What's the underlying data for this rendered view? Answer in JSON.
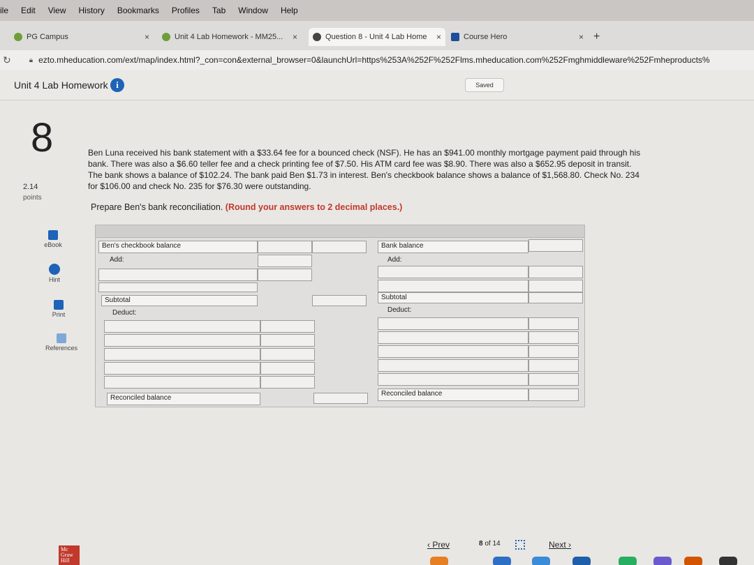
{
  "menubar": {
    "items": [
      "ile",
      "Edit",
      "View",
      "History",
      "Bookmarks",
      "Profiles",
      "Tab",
      "Window",
      "Help"
    ]
  },
  "tabs": [
    {
      "label": "PG Campus",
      "close": "×"
    },
    {
      "label": "Unit 4 Lab Homework - MM25...",
      "close": "×"
    },
    {
      "label": "Question 8 - Unit 4 Lab Home",
      "close": "×"
    },
    {
      "label": "Course Hero",
      "close": "×"
    }
  ],
  "new_tab": "+",
  "address": {
    "url": "ezto.mheducation.com/ext/map/index.html?_con=con&external_browser=0&launchUrl=https%253A%252F%252Flms.mheducation.com%252Fmghmiddleware%252Fmheproducts%"
  },
  "assignment": {
    "title": "Unit 4 Lab Homework",
    "saved": "Saved"
  },
  "question": {
    "number": "8",
    "points_value": "2.14",
    "points_label": "points",
    "text": "Ben Luna received his bank statement with a $33.64 fee for a bounced check (NSF). He has an $941.00 monthly mortgage payment paid through his bank. There was also a $6.60 teller fee and a check printing fee of $7.50. His ATM card fee was $8.90. There was also a $652.95 deposit in transit. The bank shows a balance of $102.24. The bank paid Ben $1.73 in interest. Ben's checkbook balance shows a balance of $1,568.80. Check No. 234 for $106.00 and check No. 235 for $76.30 were outstanding.",
    "prepare": "Prepare Ben's bank reconciliation.",
    "instruction": "(Round your answers to 2 decimal places.)"
  },
  "tools": [
    {
      "label": "eBook",
      "icon": "ebook-icon"
    },
    {
      "label": "Hint",
      "icon": "hint-icon"
    },
    {
      "label": "Print",
      "icon": "print-icon"
    },
    {
      "label": "References",
      "icon": "references-icon"
    }
  ],
  "recon": {
    "left": {
      "balance_label": "Ben's checkbook balance",
      "add_label": "Add:",
      "subtotal_label": "Subtotal",
      "deduct_label": "Deduct:",
      "reconciled_label": "Reconciled balance"
    },
    "right": {
      "balance_label": "Bank balance",
      "add_label": "Add:",
      "subtotal_label": "Subtotal",
      "deduct_label": "Deduct:",
      "reconciled_label": "Reconciled balance"
    }
  },
  "nav": {
    "prev": "Prev",
    "page_current": "8",
    "page_of": "of",
    "page_total": "14",
    "next": "Next"
  },
  "logo": {
    "text": "Mc Graw Hill"
  },
  "colors": {
    "accent": "#1d63b8",
    "instruction_red": "#c0392b"
  }
}
